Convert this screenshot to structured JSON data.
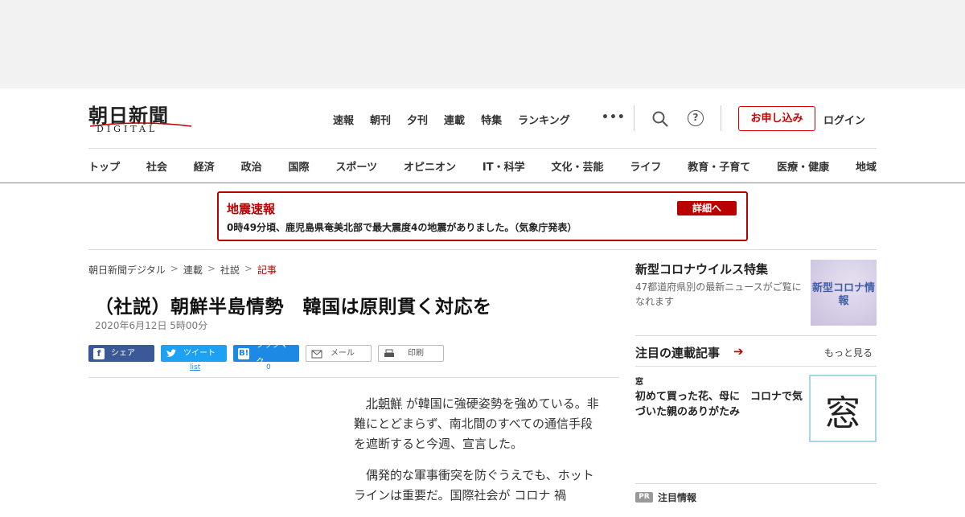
{
  "header": {
    "logo_jp": "朝日新聞",
    "logo_en": "DIGITAL",
    "topnav": [
      "速報",
      "朝刊",
      "夕刊",
      "連載",
      "特集",
      "ランキング"
    ],
    "more": "•••",
    "help": "?",
    "apply_button": "お申し込み",
    "login": "ログイン"
  },
  "categories": [
    "トップ",
    "社会",
    "経済",
    "政治",
    "国際",
    "スポーツ",
    "オピニオン",
    "IT・科学",
    "文化・芸能",
    "ライフ",
    "教育・子育て",
    "医療・健康",
    "地域"
  ],
  "quake": {
    "title": "地震速報",
    "button": "詳細へ",
    "text": "0時49分頃、鹿児島県奄美北部で最大震度4の地震がありました。（気象庁発表）",
    "accent": "#bb0000"
  },
  "breadcrumb": [
    "朝日新聞デジタル",
    "連載",
    "社説",
    "記事"
  ],
  "article": {
    "headline": "（社説）朝鮮半島情勢　韓国は原則貫く対応を",
    "date": "2020年6月12日 5時00分",
    "share": {
      "facebook": "シェア",
      "twitter": "ツイート",
      "hatena": "ブックマーク",
      "mail": "メール",
      "print": "印刷",
      "twitter_count": "list",
      "hatena_count": "0"
    },
    "para1_link": "北朝鮮",
    "para1_rest": " が韓国に強硬姿勢を強めている。非難にとどまらず、南北間のすべての通信手段を遮断すると今週、宣言した。",
    "para2": "偶発的な軍事衝突を防ぐうえでも、ホットラインは重要だ。国際社会が コロナ 禍"
  },
  "sidebar": {
    "corona_title": "新型コロナウイルス特集",
    "corona_desc": "47都道府県別の最新ニュースがご覧になれます",
    "corona_image_text": "新型コロナ情報",
    "serial_heading": "注目の連載記事",
    "more_link": "もっと見る",
    "serial_tag": "窓",
    "serial_item": "初めて買った花、母に　コロナで気づいた親のありがたみ",
    "mado_char": "窓",
    "pr_badge": "PR",
    "pr_text": "注目情報"
  }
}
